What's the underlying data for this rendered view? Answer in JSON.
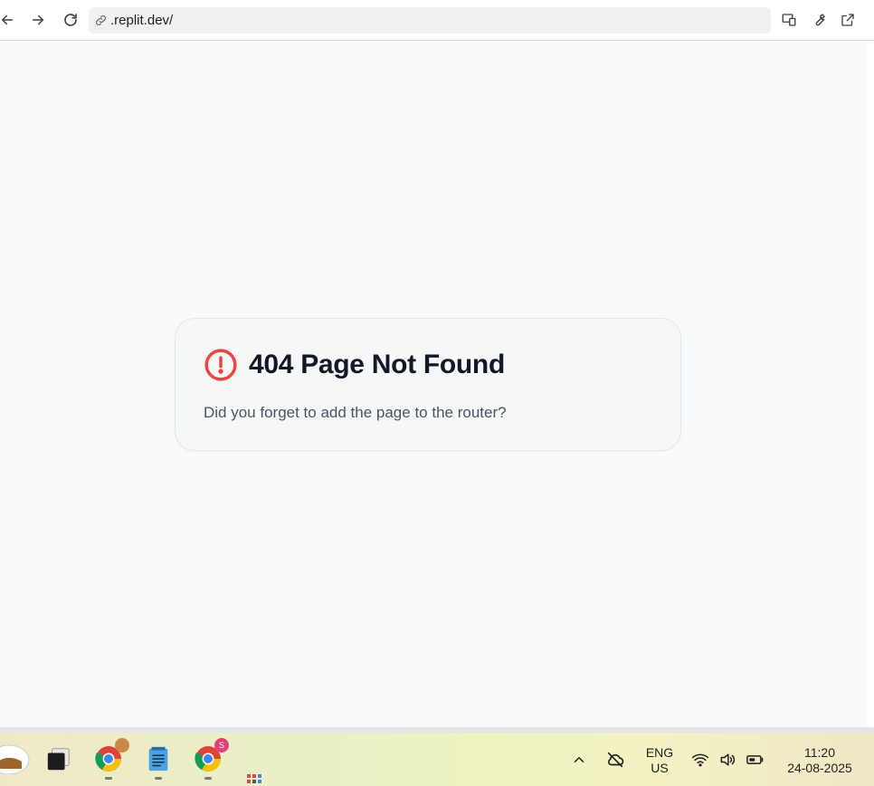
{
  "browser": {
    "url": ".replit.dev/"
  },
  "card": {
    "title": "404 Page Not Found",
    "description": "Did you forget to add the page to the router?"
  },
  "taskbar": {
    "language_line1": "ENG",
    "language_line2": "US",
    "time": "11:20",
    "date": "24-08-2025",
    "chrome_badge": "S"
  },
  "colors": {
    "alert": "#ef4444",
    "title": "#111827",
    "description": "#4b5563"
  }
}
